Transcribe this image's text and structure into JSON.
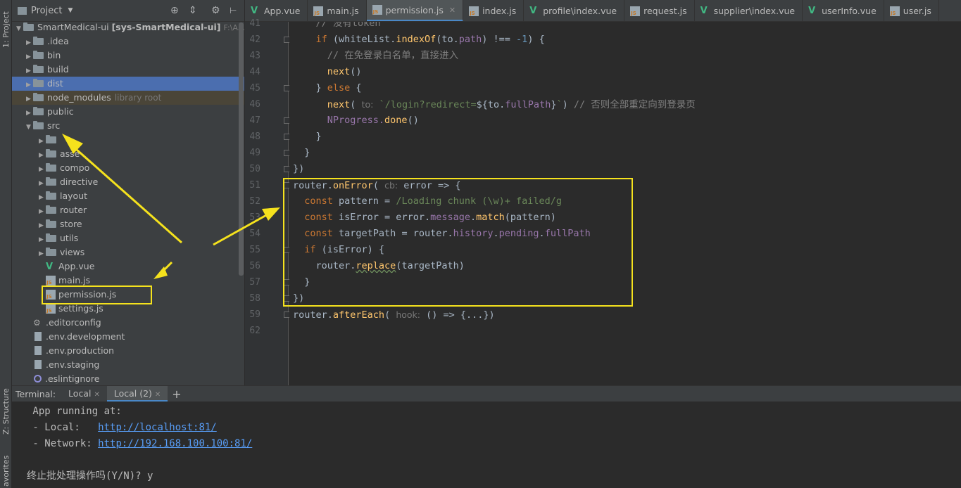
{
  "left_strip": {
    "project_tab": "1: Project",
    "structure_tab": "Z: Structure",
    "favorites_tab": "avorites"
  },
  "project_panel": {
    "title": "Project",
    "root": {
      "name": "SmartMedical-ui",
      "module": "[sys-SmartMedical-ui]",
      "path": "F:\\AAAAA"
    },
    "items": [
      {
        "label": "idea",
        "prefix": ".",
        "type": "folder",
        "level": 1,
        "expanded": false
      },
      {
        "label": "bin",
        "type": "folder",
        "level": 1,
        "expanded": false
      },
      {
        "label": "build",
        "type": "folder",
        "level": 1,
        "expanded": false
      },
      {
        "label": "dist",
        "type": "folder",
        "level": 1,
        "expanded": false,
        "selected": true
      },
      {
        "label": "node_modules",
        "type": "folder",
        "level": 1,
        "expanded": false,
        "tag": "library root"
      },
      {
        "label": "public",
        "type": "folder",
        "level": 1,
        "expanded": false
      },
      {
        "label": "src",
        "type": "folder",
        "level": 1,
        "expanded": true
      },
      {
        "label": "",
        "type": "folder",
        "level": 2,
        "expanded": false
      },
      {
        "label": "asse",
        "type": "folder",
        "level": 2,
        "expanded": false
      },
      {
        "label": "compo",
        "type": "folder",
        "level": 2,
        "expanded": false
      },
      {
        "label": "directive",
        "type": "folder",
        "level": 2,
        "expanded": false
      },
      {
        "label": "layout",
        "type": "folder",
        "level": 2,
        "expanded": false
      },
      {
        "label": "router",
        "type": "folder",
        "level": 2,
        "expanded": false
      },
      {
        "label": "store",
        "type": "folder",
        "level": 2,
        "expanded": false
      },
      {
        "label": "utils",
        "type": "folder",
        "level": 2,
        "expanded": false
      },
      {
        "label": "views",
        "type": "folder",
        "level": 2,
        "expanded": false
      },
      {
        "label": "App.vue",
        "type": "vue",
        "level": 2
      },
      {
        "label": "main.js",
        "type": "js",
        "level": 2
      },
      {
        "label": "permission.js",
        "type": "js",
        "level": 2
      },
      {
        "label": "settings.js",
        "type": "js",
        "level": 2
      },
      {
        "label": ".editorconfig",
        "type": "gear",
        "level": 1
      },
      {
        "label": ".env.development",
        "type": "doc",
        "level": 1
      },
      {
        "label": ".env.production",
        "type": "doc",
        "level": 1
      },
      {
        "label": ".env.staging",
        "type": "doc",
        "level": 1
      },
      {
        "label": ".eslintignore",
        "type": "circle",
        "level": 1
      }
    ]
  },
  "editor_tabs": [
    {
      "label": "App.vue",
      "type": "vue"
    },
    {
      "label": "main.js",
      "type": "js"
    },
    {
      "label": "permission.js",
      "type": "js",
      "active": true
    },
    {
      "label": "index.js",
      "type": "js"
    },
    {
      "label": "profile\\index.vue",
      "type": "vue"
    },
    {
      "label": "request.js",
      "type": "js"
    },
    {
      "label": "supplier\\index.vue",
      "type": "vue"
    },
    {
      "label": "userInfo.vue",
      "type": "vue"
    },
    {
      "label": "user.js",
      "type": "js"
    }
  ],
  "editor": {
    "line_numbers": [
      "41",
      "42",
      "43",
      "44",
      "45",
      "46",
      "47",
      "48",
      "49",
      "50",
      "51",
      "52",
      "53",
      "54",
      "55",
      "56",
      "57",
      "58",
      "59",
      "62"
    ],
    "lines": [
      [
        {
          "t": "    // 没有token",
          "c": "cm"
        }
      ],
      [
        {
          "t": "    "
        },
        {
          "t": "if",
          "c": "kw"
        },
        {
          "t": " (whiteList."
        },
        {
          "t": "indexOf",
          "c": "fn"
        },
        {
          "t": "(to."
        },
        {
          "t": "path",
          "c": "pr"
        },
        {
          "t": ") !== "
        },
        {
          "t": "-1",
          "c": "nu"
        },
        {
          "t": ") {"
        }
      ],
      [
        {
          "t": "      // 在免登录白名单，直接进入",
          "c": "cm"
        }
      ],
      [
        {
          "t": "      "
        },
        {
          "t": "next",
          "c": "fn"
        },
        {
          "t": "()"
        }
      ],
      [
        {
          "t": "    } "
        },
        {
          "t": "else",
          "c": "kw"
        },
        {
          "t": " {"
        }
      ],
      [
        {
          "t": "      "
        },
        {
          "t": "next",
          "c": "fn"
        },
        {
          "t": "( "
        },
        {
          "t": "to:",
          "c": "hint"
        },
        {
          "t": " "
        },
        {
          "t": "`/login?redirect=",
          "c": "st"
        },
        {
          "t": "${"
        },
        {
          "t": "to.",
          "c": ""
        },
        {
          "t": "fullPath",
          "c": "pr"
        },
        {
          "t": "}"
        },
        {
          "t": "`",
          "c": "st"
        },
        {
          "t": ") "
        },
        {
          "t": "// 否则全部重定向到登录页",
          "c": "cm"
        }
      ],
      [
        {
          "t": "      NProgress.",
          "c": "pr"
        },
        {
          "t": "done",
          "c": "fn"
        },
        {
          "t": "()"
        }
      ],
      [
        {
          "t": "    }"
        }
      ],
      [
        {
          "t": "  }"
        }
      ],
      [
        {
          "t": "})"
        }
      ],
      [
        {
          "t": "router."
        },
        {
          "t": "onError",
          "c": "fn"
        },
        {
          "t": "( "
        },
        {
          "t": "cb:",
          "c": "hint"
        },
        {
          "t": " error => {"
        }
      ],
      [
        {
          "t": "  "
        },
        {
          "t": "const",
          "c": "kw"
        },
        {
          "t": " pattern = "
        },
        {
          "t": "/Loading chunk (\\w)+ failed/g",
          "c": "st"
        }
      ],
      [
        {
          "t": "  "
        },
        {
          "t": "const",
          "c": "kw"
        },
        {
          "t": " isError = error."
        },
        {
          "t": "message",
          "c": "pr"
        },
        {
          "t": "."
        },
        {
          "t": "match",
          "c": "fn"
        },
        {
          "t": "(pattern)"
        }
      ],
      [
        {
          "t": "  "
        },
        {
          "t": "const",
          "c": "kw"
        },
        {
          "t": " targetPath = router."
        },
        {
          "t": "history",
          "c": "pr"
        },
        {
          "t": "."
        },
        {
          "t": "pending",
          "c": "pr"
        },
        {
          "t": "."
        },
        {
          "t": "fullPath",
          "c": "pr"
        }
      ],
      [
        {
          "t": "  "
        },
        {
          "t": "if",
          "c": "kw"
        },
        {
          "t": " (isError) {"
        }
      ],
      [
        {
          "t": "    router."
        },
        {
          "t": "replace",
          "c": "fn ul"
        },
        {
          "t": "(targetPath)"
        }
      ],
      [
        {
          "t": "  }"
        }
      ],
      [
        {
          "t": "})"
        }
      ],
      [
        {
          "t": "router."
        },
        {
          "t": "afterEach",
          "c": "fn"
        },
        {
          "t": "( "
        },
        {
          "t": "hook:",
          "c": "hint"
        },
        {
          "t": " () => {...})"
        }
      ],
      [
        {
          "t": ""
        }
      ]
    ]
  },
  "terminal": {
    "label": "Terminal:",
    "tabs": [
      "Local",
      "Local (2)"
    ],
    "add_label": "+",
    "lines": [
      {
        "text": " App running at:"
      },
      {
        "text": " - Local:   ",
        "link": "http://localhost:81/"
      },
      {
        "text": " - Network: ",
        "link": "http://192.168.100.100:81/"
      },
      {
        "text": ""
      },
      {
        "text": "终止批处理操作吗(Y/N)? y"
      }
    ]
  },
  "colors": {
    "annotation": "#f5e21d",
    "selection": "#4b6eaf",
    "accent": "#4a88c7"
  }
}
